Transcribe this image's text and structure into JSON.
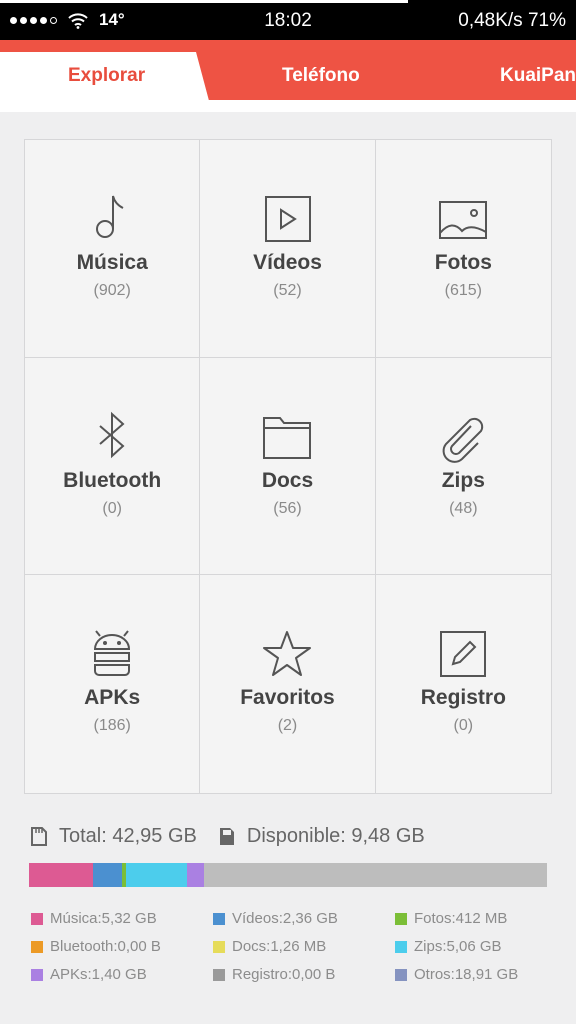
{
  "status_bar": {
    "temperature": "14°",
    "time": "18:02",
    "network_battery": "0,48K/s 71%"
  },
  "tabs": [
    {
      "label": "Explorar",
      "active": true
    },
    {
      "label": "Teléfono",
      "active": false
    },
    {
      "label": "KuaiPan",
      "active": false
    }
  ],
  "categories": [
    {
      "label": "Música",
      "count": "(902)",
      "icon": "music-note-icon"
    },
    {
      "label": "Vídeos",
      "count": "(52)",
      "icon": "video-play-icon"
    },
    {
      "label": "Fotos",
      "count": "(615)",
      "icon": "image-icon"
    },
    {
      "label": "Bluetooth",
      "count": "(0)",
      "icon": "bluetooth-icon"
    },
    {
      "label": "Docs",
      "count": "(56)",
      "icon": "folder-icon"
    },
    {
      "label": "Zips",
      "count": "(48)",
      "icon": "paperclip-icon"
    },
    {
      "label": "APKs",
      "count": "(186)",
      "icon": "android-icon"
    },
    {
      "label": "Favoritos",
      "count": "(2)",
      "icon": "star-icon"
    },
    {
      "label": "Registro",
      "count": "(0)",
      "icon": "edit-icon"
    }
  ],
  "storage": {
    "total": "Total: 42,95 GB",
    "available": "Disponible: 9,48 GB",
    "total_gb": 42.95,
    "rest_color": "#bdbdbd"
  },
  "legend": [
    {
      "text": "Música:5,32 GB",
      "color": "#dd5a93",
      "gb": 5.32
    },
    {
      "text": "Vídeos:2,36 GB",
      "color": "#4b90d0",
      "gb": 2.36
    },
    {
      "text": "Fotos:412 MB",
      "color": "#7bbe37",
      "gb": 0.4
    },
    {
      "text": "Bluetooth:0,00 B",
      "color": "#ec9a26",
      "gb": 0
    },
    {
      "text": "Docs:1,26 MB",
      "color": "#e6dc5a",
      "gb": 0.001
    },
    {
      "text": "Zips:5,06 GB",
      "color": "#4ccdec",
      "gb": 5.06
    },
    {
      "text": "APKs:1,40 GB",
      "color": "#aa80e2",
      "gb": 1.4
    },
    {
      "text": "Registro:0,00 B",
      "color": "#9a9a9a",
      "gb": 0
    },
    {
      "text": "Otros:18,91 GB",
      "color": "#8593c0",
      "gb": 18.91
    }
  ]
}
